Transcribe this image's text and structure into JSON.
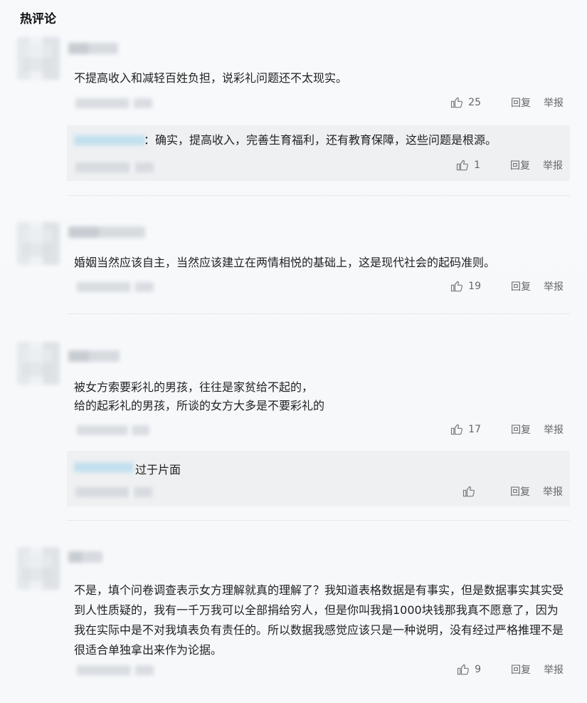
{
  "section": {
    "title": "热评论"
  },
  "comments": [
    {
      "text": "不提高收入和减轻百姓负担，说彩礼问题还不太现实。",
      "likes": "25",
      "reply_label": "回复",
      "report_label": "举报",
      "reply": {
        "text": "：确实，提高收入，完善生育福利，还有教育保障，这些问题是根源。",
        "likes": "1",
        "reply_label": "回复",
        "report_label": "举报"
      }
    },
    {
      "text": "婚姻当然应该自主，当然应该建立在两情相悦的基础上，这是现代社会的起码准则。",
      "likes": "19",
      "reply_label": "回复",
      "report_label": "举报"
    },
    {
      "text": "被女方索要彩礼的男孩，往往是家贫给不起的，\n给的起彩礼的男孩，所谈的女方大多是不要彩礼的",
      "likes": "17",
      "reply_label": "回复",
      "report_label": "举报",
      "reply": {
        "text": "过于片面",
        "likes": "",
        "reply_label": "回复",
        "report_label": "举报"
      }
    },
    {
      "text": "不是，填个问卷调查表示女方理解就真的理解了？我知道表格数据是有事实，但是数据事实其实受到人性质疑的，我有一千万我可以全部捐给穷人，但是你叫我捐1000块钱那我真不愿意了，因为我在实际中是不对我填表负有责任的。所以数据我感觉应该只是一种说明，没有经过严格推理不是很适合单独拿出来作为论据。",
      "likes": "9",
      "reply_label": "回复",
      "report_label": "举报"
    }
  ],
  "icons": {
    "like": "thumbs-up-icon"
  }
}
